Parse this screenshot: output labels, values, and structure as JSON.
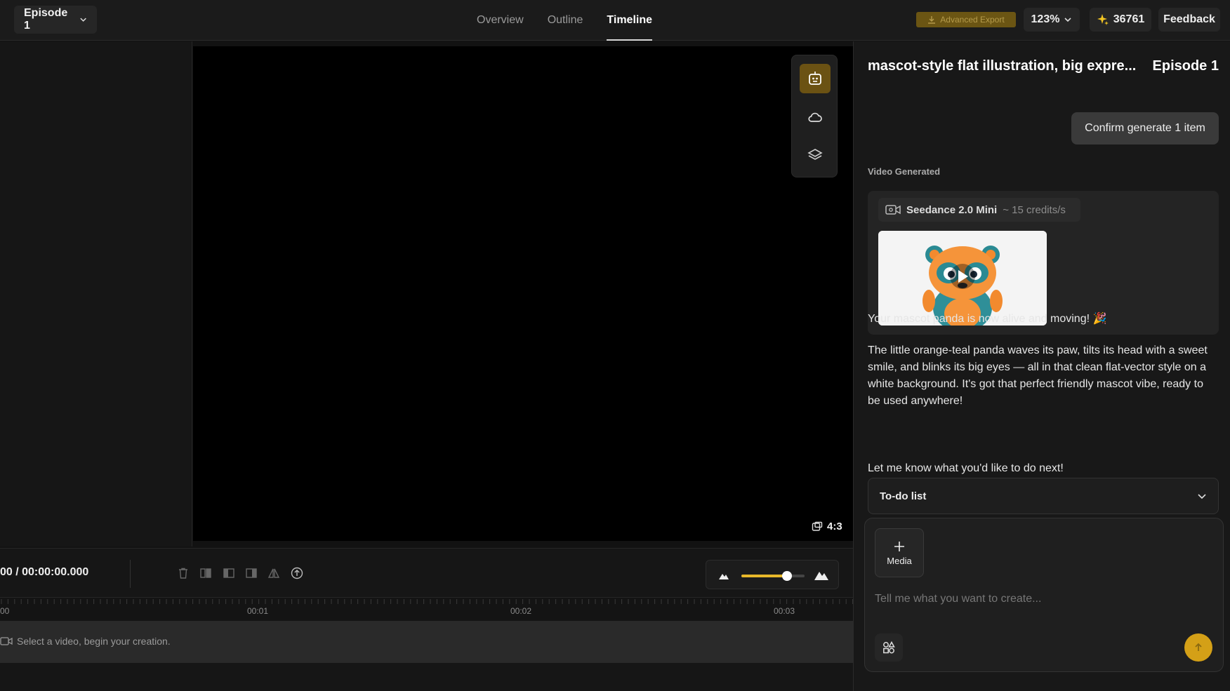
{
  "header": {
    "episode_select": "Episode 1",
    "tabs": [
      {
        "label": "Overview"
      },
      {
        "label": "Outline"
      },
      {
        "label": "Timeline"
      }
    ],
    "advanced_export": "Advanced Export",
    "zoom": "123%",
    "credits": "36761",
    "feedback": "Feedback"
  },
  "preview": {
    "aspect_ratio": "4:3"
  },
  "controls": {
    "timecode": "00 / 00:00:00.000",
    "zoom_level": 0.72
  },
  "ruler": {
    "labels": [
      {
        "text": "00"
      },
      {
        "text": "00:01"
      },
      {
        "text": "00:02"
      },
      {
        "text": "00:03"
      }
    ]
  },
  "track": {
    "hint": "Select a video, begin your creation."
  },
  "chat": {
    "title": "mascot-style flat illustration, big expre...",
    "episode": "Episode 1",
    "confirm_button": "Confirm generate 1 item",
    "video_generated_label": "Video Generated",
    "model_name": "Seedance 2.0 Mini",
    "model_credits": "~ 15 credits/s",
    "message_1": "Your mascot panda is now alive and moving! 🎉",
    "message_2": "The little orange-teal panda waves its paw, tilts its head with a sweet smile, and blinks its big eyes — all in that clean flat-vector style on a white background. It's got that perfect friendly mascot vibe, ready to be used anywhere!",
    "message_3": "Let me know what you'd like to do next!",
    "todo_label": "To-do list",
    "media_label": "Media",
    "prompt_placeholder": "Tell me what you want to create..."
  },
  "colors": {
    "accent": "#d4a017",
    "slider": "#e8b82a"
  }
}
